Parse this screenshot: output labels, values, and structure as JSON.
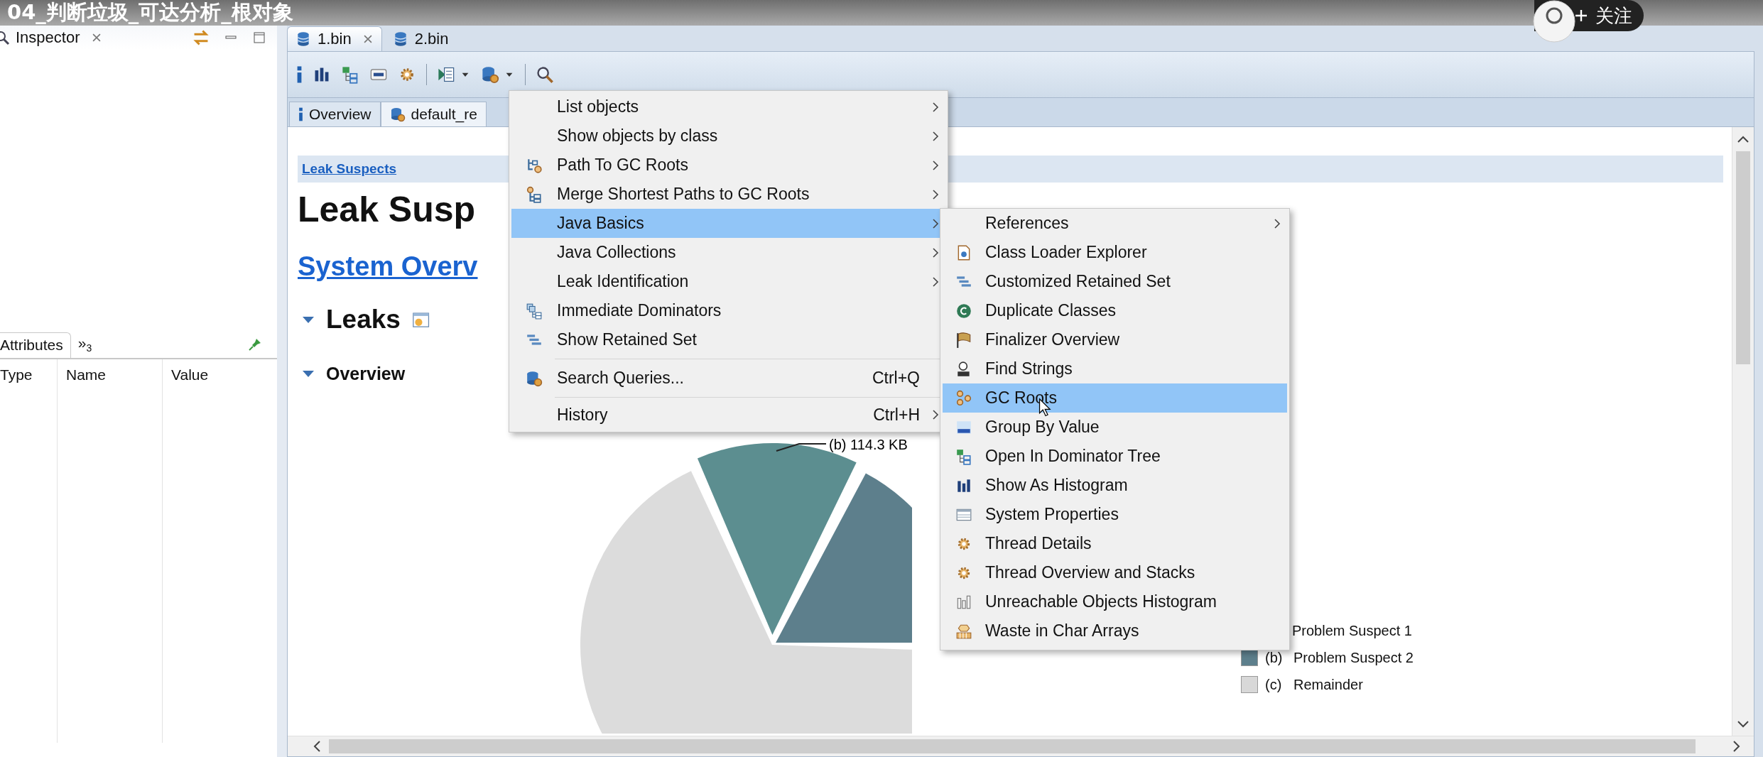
{
  "video_overlay": {
    "title": "04_判断垃圾_可达分析_根对象",
    "follow_button": "关注"
  },
  "inspector": {
    "tab": "Inspector",
    "attributes_tab": "Attributes",
    "overflow_tab": "»$_{3}$",
    "columns": [
      "Type",
      "Name",
      "Value"
    ]
  },
  "editor": {
    "tabs": [
      {
        "label": "1.bin",
        "selected": true,
        "closable": true
      },
      {
        "label": "2.bin",
        "selected": false,
        "closable": false
      }
    ],
    "subtabs": [
      {
        "label": "Overview",
        "selected": false
      },
      {
        "label": "default_re",
        "selected": true
      }
    ],
    "breadcrumb": "Leak Suspects",
    "heading": "Leak Susp",
    "link": "System Overv",
    "sections": [
      {
        "title": "Leaks",
        "kind": "major",
        "expanded": true
      },
      {
        "title": "Overview",
        "kind": "minor",
        "expanded": true
      }
    ],
    "chart": {
      "kind": "picture",
      "slice_label": "(b)  114.3 KB"
    },
    "legend": [
      {
        "label": "Problem Suspect 1"
      },
      {
        "tag": "(b)",
        "label": "Problem Suspect 2",
        "color": "#5d7f8c"
      },
      {
        "tag": "(c)",
        "label": "Remainder",
        "color": "#d8d8d8"
      }
    ]
  },
  "context_menu": {
    "items": [
      {
        "label": "List objects",
        "submenu": true,
        "selected": false
      },
      {
        "label": "Show objects by class",
        "submenu": true,
        "selected": false
      },
      {
        "label": "Path To GC Roots",
        "submenu": true,
        "selected": false
      },
      {
        "label": "Merge Shortest Paths to GC Roots",
        "submenu": true,
        "selected": false
      },
      {
        "label": "Java Basics",
        "submenu": true,
        "selected": true
      },
      {
        "label": "Java Collections",
        "submenu": true,
        "selected": false
      },
      {
        "label": "Leak Identification",
        "submenu": true,
        "selected": false
      },
      {
        "label": "Immediate Dominators",
        "submenu": false,
        "selected": false
      },
      {
        "label": "Show Retained Set",
        "submenu": false,
        "selected": false
      },
      {
        "label": "Search Queries...",
        "shortcut": "Ctrl+Q",
        "submenu": false,
        "selected": false,
        "separator_before": true
      },
      {
        "label": "History",
        "shortcut": "Ctrl+H",
        "submenu": true,
        "selected": false,
        "separator_before": true
      }
    ]
  },
  "submenu": {
    "items": [
      {
        "label": "References",
        "submenu": true,
        "selected": false
      },
      {
        "label": "Class Loader Explorer",
        "submenu": false,
        "selected": false
      },
      {
        "label": "Customized Retained Set",
        "submenu": false,
        "selected": false
      },
      {
        "label": "Duplicate Classes",
        "submenu": false,
        "selected": false
      },
      {
        "label": "Finalizer Overview",
        "submenu": false,
        "selected": false
      },
      {
        "label": "Find Strings",
        "submenu": false,
        "selected": false
      },
      {
        "label": "GC Roots",
        "submenu": false,
        "selected": true
      },
      {
        "label": "Group By Value",
        "submenu": false,
        "selected": false
      },
      {
        "label": "Open In Dominator Tree",
        "submenu": false,
        "selected": false
      },
      {
        "label": "Show As Histogram",
        "submenu": false,
        "selected": false
      },
      {
        "label": "System Properties",
        "submenu": false,
        "selected": false
      },
      {
        "label": "Thread Details",
        "submenu": false,
        "selected": false
      },
      {
        "label": "Thread Overview and Stacks",
        "submenu": false,
        "selected": false
      },
      {
        "label": "Unreachable Objects Histogram",
        "submenu": false,
        "selected": false
      },
      {
        "label": "Waste in Char Arrays",
        "submenu": false,
        "selected": false
      }
    ]
  }
}
